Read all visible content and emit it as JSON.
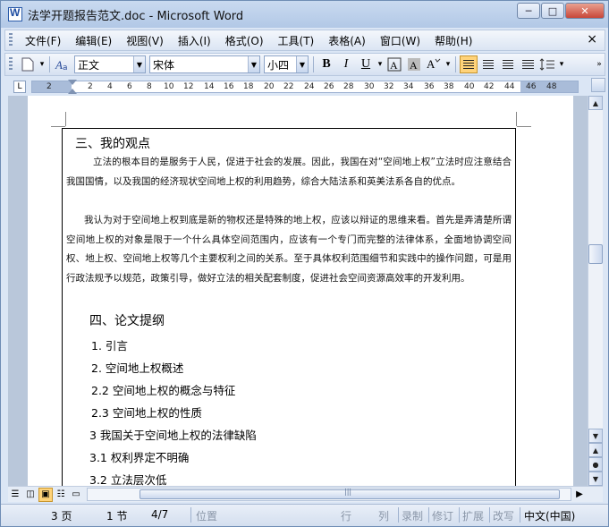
{
  "window": {
    "title": "法学开题报告范文.doc - Microsoft Word",
    "minimize": "─",
    "maximize": "□",
    "close": "✕"
  },
  "menu": {
    "items": [
      "文件(F)",
      "编辑(E)",
      "视图(V)",
      "插入(I)",
      "格式(O)",
      "工具(T)",
      "表格(A)",
      "窗口(W)",
      "帮助(H)"
    ],
    "close_doc": "×"
  },
  "toolbar": {
    "style_value": "正文",
    "font_value": "宋体",
    "size_value": "小四",
    "bold": "B",
    "italic": "I",
    "underline": "U",
    "icons": [
      "new-document-icon",
      "style-icon",
      "border-char-icon",
      "shading-char-icon",
      "highlight-icon",
      "align-left-icon",
      "align-center-icon",
      "align-right-icon",
      "justify-icon",
      "line-spacing-icon"
    ]
  },
  "ruler": {
    "tab_selector": "L",
    "ticks": [
      "2",
      "2",
      "4",
      "6",
      "8",
      "10",
      "12",
      "14",
      "16",
      "18",
      "20",
      "22",
      "24",
      "26",
      "28",
      "30",
      "32",
      "34",
      "36",
      "38",
      "40",
      "42",
      "44",
      "46",
      "48"
    ]
  },
  "document": {
    "heading3": "三、我的观点",
    "para1": "立法的根本目的是服务于人民，促进于社会的发展。因此，我国在对“空间地上权”立法时应注意结合我国国情，以及我国的经济现状空间地上权的利用趋势，综合大陆法系和英美法系各自的优点。",
    "para2": "我认为对于空间地上权到底是新的物权还是特殊的地上权，应该以辩证的思维来看。首先是弄清楚所谓空间地上权的对象是限于一个什么具体空间范围内，应该有一个专门而完整的法律体系，全面地协调空间权、地上权、空间地上权等几个主要权利之间的关系。至于具体权利范围细节和实践中的操作问题，可是用行政法规予以规范，政策引导，做好立法的相关配套制度，促进社会空间资源高效率的开发利用。",
    "heading4": "四、论文提纲",
    "outline": [
      "1. 引言",
      "2. 空间地上权概述",
      "2.2 空间地上权的概念与特征",
      "2.3 空间地上权的性质",
      "3 我国关于空间地上权的法律缺陷",
      "3.1 权利界定不明确",
      "3.2  立法层次低"
    ]
  },
  "statusbar": {
    "page": "3 页",
    "section": "1 节",
    "page_of": "4/7",
    "position": "位置",
    "line": "行",
    "column": "列",
    "record": "录制",
    "revise": "修订",
    "extend": "扩展",
    "overwrite": "改写",
    "language": "中文(中国)"
  }
}
